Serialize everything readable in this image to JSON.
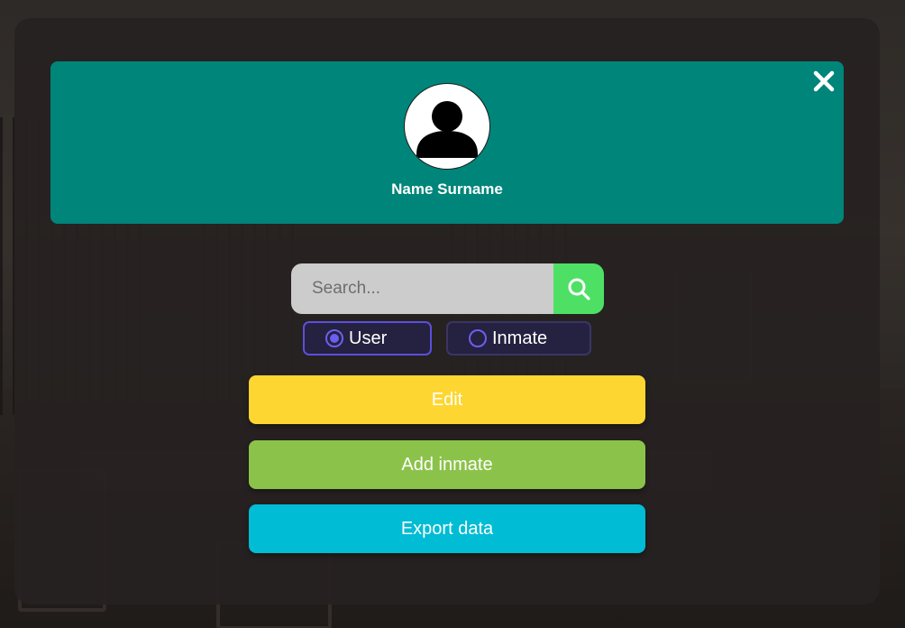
{
  "profile": {
    "name": "Name Surname",
    "avatar_icon": "user-avatar-icon",
    "close_icon": "close-icon",
    "card_color": "#00857a"
  },
  "search": {
    "placeholder": "Search...",
    "value": "",
    "button_icon": "search-icon",
    "button_color": "#4ee065"
  },
  "radio_options": [
    {
      "label": "User",
      "selected": true
    },
    {
      "label": "Inmate",
      "selected": false
    }
  ],
  "actions": {
    "edit_label": "Edit",
    "add_inmate_label": "Add inmate",
    "export_label": "Export data"
  },
  "colors": {
    "edit": "#fdd631",
    "add_inmate": "#8bc34a",
    "export": "#00bcd4",
    "radio_accent": "#6b5ff0"
  }
}
